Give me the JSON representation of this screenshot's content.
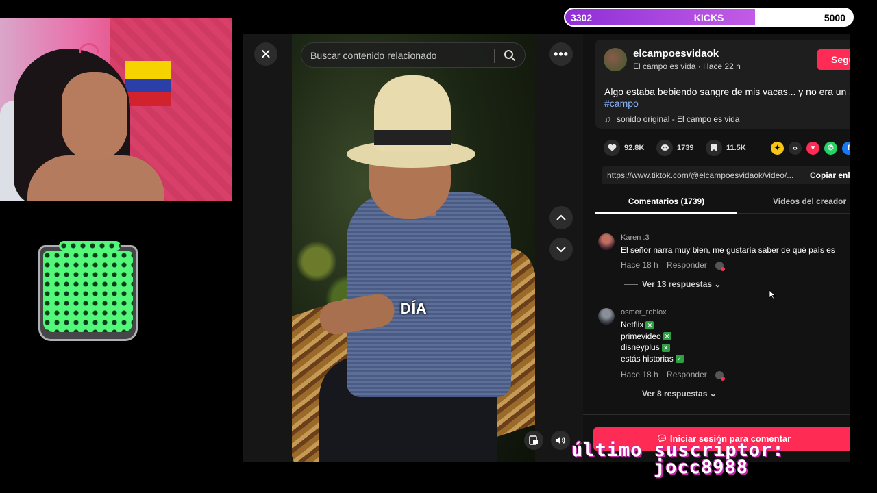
{
  "kicks_goal": {
    "current": "3302",
    "label": "KICKS",
    "goal": "5000",
    "progress": 0.6604
  },
  "modal": {
    "search_placeholder": "Buscar contenido relacionado",
    "video_caption": "DÍA"
  },
  "post": {
    "username": "elcampoesvidaok",
    "subtitle": "El campo es vida · Hace 22 h",
    "follow_label": "Seguir",
    "description": "Algo estaba bebiendo sangre de mis vacas... y no era un an",
    "hashtag": "#campo",
    "sound": "sonido original - El campo es vida"
  },
  "actions": {
    "likes": "92.8K",
    "comments": "1739",
    "saves": "11.5K"
  },
  "share_link": {
    "url": "https://www.tiktok.com/@elcampoesvidaok/video/...",
    "copy_label": "Copiar enl"
  },
  "tabs": {
    "comments": "Comentarios (1739)",
    "creator_videos": "Videos del creador"
  },
  "comments": [
    {
      "user": "Karen :3",
      "lines": [
        "El señor narra muy bien, me gustaría saber de qué país es"
      ],
      "time": "Hace 18 h",
      "reply_label": "Responder",
      "replies": "Ver 13 respuestas"
    },
    {
      "user": "osmer_roblox",
      "lines": [
        "Netflix",
        "primevideo",
        "disneyplus",
        "estás historias"
      ],
      "time": "Hace 18 h",
      "reply_label": "Responder",
      "replies": "Ver 8 respuestas"
    }
  ],
  "login_comment": "Iniciar sesión para comentar",
  "overlay": {
    "last_sub_label": "último suscriptor:",
    "last_sub_name": "jocc8988"
  },
  "colors": {
    "accent": "#fe2c55",
    "kicks_fill": "#a944e0",
    "hashtag": "#8ab4f8"
  }
}
